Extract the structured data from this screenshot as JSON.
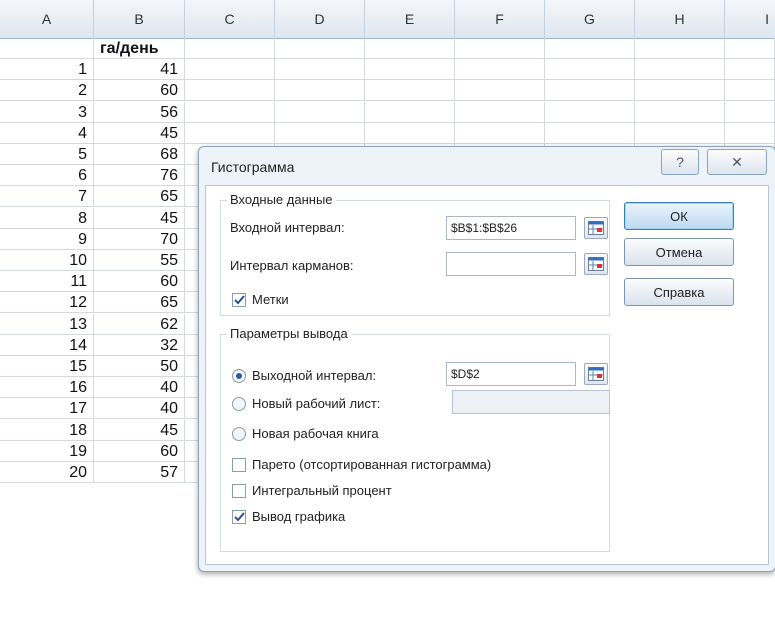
{
  "sheet": {
    "columns": [
      "A",
      "B",
      "C",
      "D",
      "E",
      "F",
      "G",
      "H",
      "I"
    ],
    "b_header": "га/день",
    "rows": [
      {
        "a": "1",
        "b": "41"
      },
      {
        "a": "2",
        "b": "60"
      },
      {
        "a": "3",
        "b": "56"
      },
      {
        "a": "4",
        "b": "45"
      },
      {
        "a": "5",
        "b": "68"
      },
      {
        "a": "6",
        "b": "76"
      },
      {
        "a": "7",
        "b": "65"
      },
      {
        "a": "8",
        "b": "45"
      },
      {
        "a": "9",
        "b": "70"
      },
      {
        "a": "10",
        "b": "55"
      },
      {
        "a": "11",
        "b": "60"
      },
      {
        "a": "12",
        "b": "65"
      },
      {
        "a": "13",
        "b": "62"
      },
      {
        "a": "14",
        "b": "32"
      },
      {
        "a": "15",
        "b": "50"
      },
      {
        "a": "16",
        "b": "40"
      },
      {
        "a": "17",
        "b": "40"
      },
      {
        "a": "18",
        "b": "45"
      },
      {
        "a": "19",
        "b": "60"
      },
      {
        "a": "20",
        "b": "57"
      }
    ]
  },
  "dialog": {
    "title": "Гистограмма",
    "help_glyph": "?",
    "close_glyph": "✕",
    "input_group": {
      "label": "Входные данные",
      "input_range_label": "Входной интервал:",
      "input_range_value": "$B$1:$B$26",
      "bin_range_label": "Интервал карманов:",
      "bin_range_value": "",
      "labels_label": "Метки",
      "labels_checked": true
    },
    "output_group": {
      "label": "Параметры вывода",
      "output_range_label": "Выходной интервал:",
      "output_range_value": "$D$2",
      "new_sheet_label": "Новый рабочий лист:",
      "new_sheet_value": "",
      "new_workbook_label": "Новая рабочая книга",
      "selected_option": "output_range",
      "pareto_label": "Парето (отсортированная гистограмма)",
      "pareto_checked": false,
      "cumulative_label": "Интегральный процент",
      "cumulative_checked": false,
      "chart_label": "Вывод графика",
      "chart_checked": true
    },
    "buttons": {
      "ok": "ОК",
      "cancel": "Отмена",
      "help": "Справка"
    }
  }
}
